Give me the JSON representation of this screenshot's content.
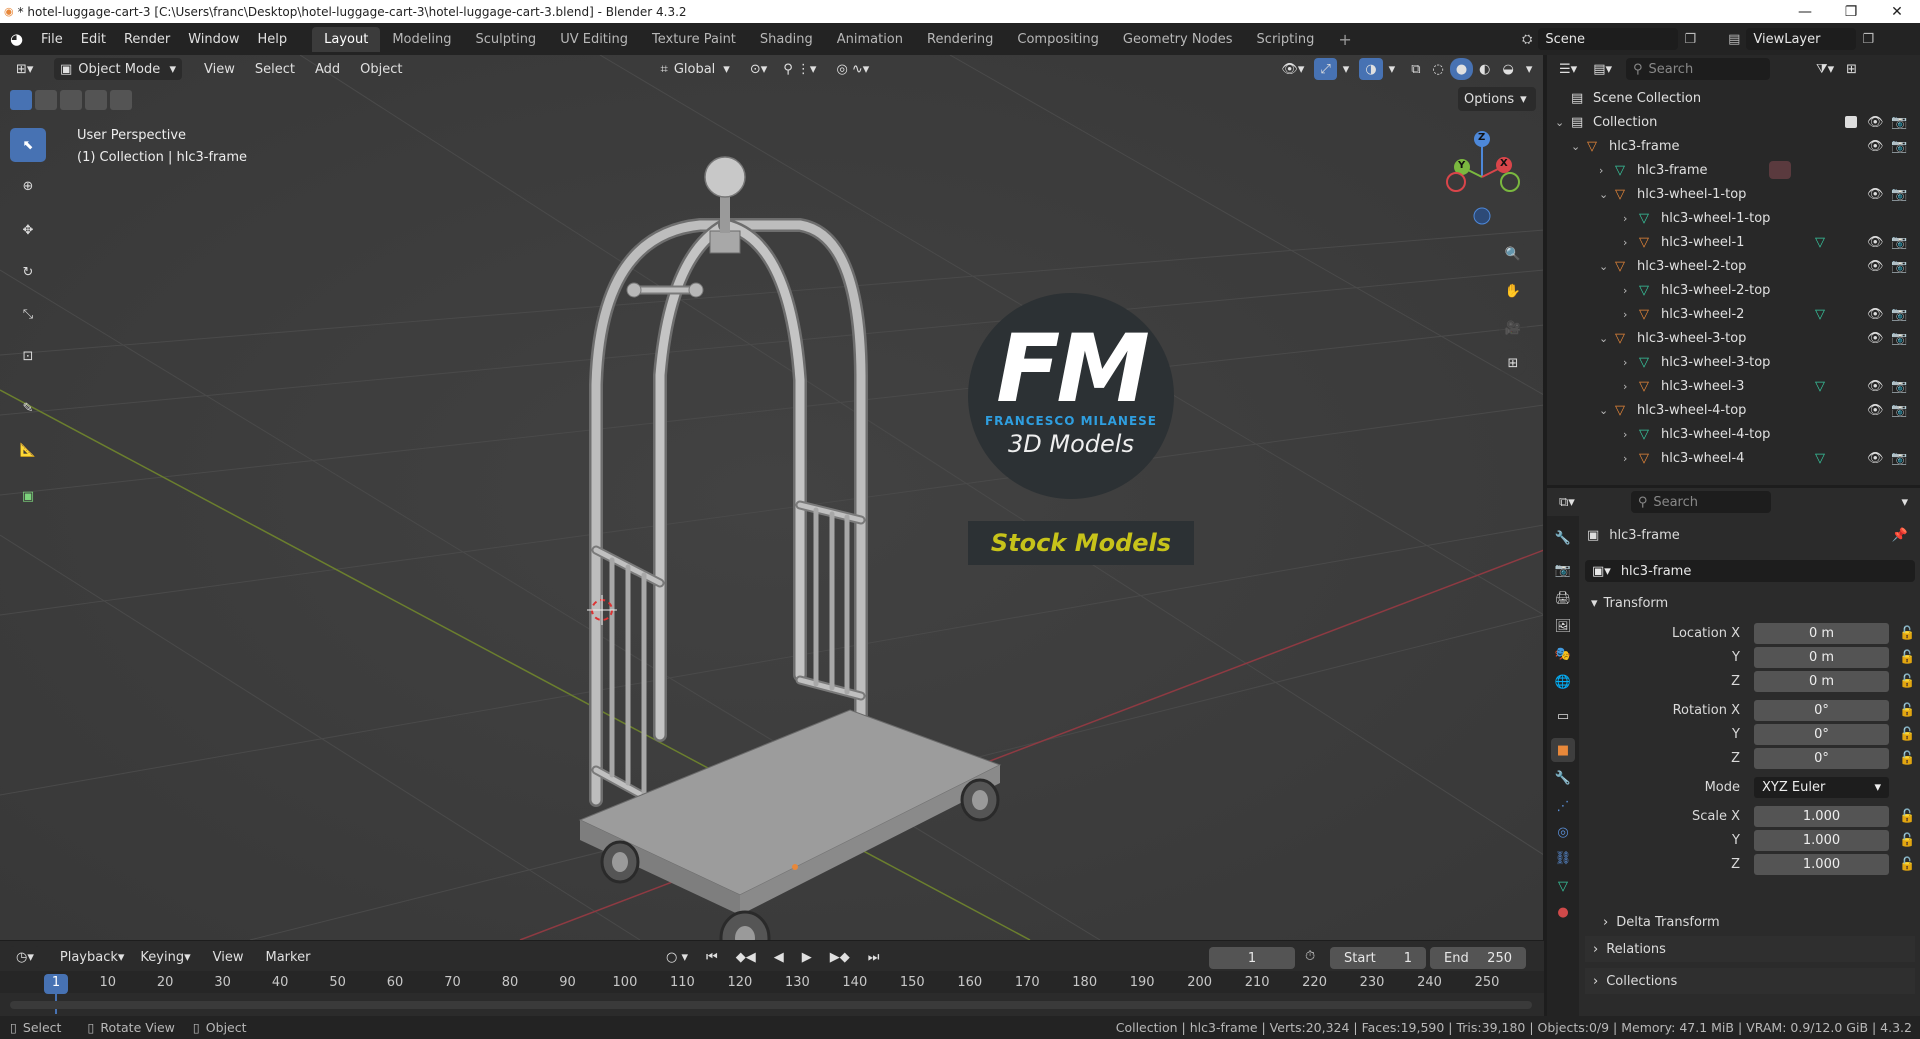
{
  "window": {
    "title": "* hotel-luggage-cart-3 [C:\\Users\\franc\\Desktop\\hotel-luggage-cart-3\\hotel-luggage-cart-3.blend] - Blender 4.3.2",
    "minimize": "—",
    "maximize": "❐",
    "close": "✕"
  },
  "menu": [
    "File",
    "Edit",
    "Render",
    "Window",
    "Help"
  ],
  "workspaces": [
    "Layout",
    "Modeling",
    "Sculpting",
    "UV Editing",
    "Texture Paint",
    "Shading",
    "Animation",
    "Rendering",
    "Compositing",
    "Geometry Nodes",
    "Scripting"
  ],
  "active_workspace": "Layout",
  "scene": {
    "label": "Scene",
    "view_layer": "ViewLayer"
  },
  "viewport": {
    "mode": "Object Mode",
    "menus": [
      "View",
      "Select",
      "Add",
      "Object"
    ],
    "orientation": "Global",
    "options_label": "Options",
    "overlay_title": "User Perspective",
    "overlay_sub": "(1) Collection | hlc3-frame",
    "gizmo_z": "Z",
    "gizmo_y": "Y",
    "gizmo_x": "X",
    "watermark_fm": "FM",
    "watermark_name": "FRANCESCO MILANESE",
    "watermark_3d": "3D Models",
    "watermark_stock": "Stock Models"
  },
  "outliner": {
    "search_placeholder": "Search",
    "rows": [
      {
        "label": "Scene Collection",
        "depth": 0
      },
      {
        "label": "Collection",
        "depth": 1
      },
      {
        "label": "hlc3-frame",
        "depth": 2
      },
      {
        "label": "hlc3-frame",
        "depth": 3
      },
      {
        "label": "hlc3-wheel-1-top",
        "depth": 3
      },
      {
        "label": "hlc3-wheel-1-top",
        "depth": 4
      },
      {
        "label": "hlc3-wheel-1",
        "depth": 4
      },
      {
        "label": "hlc3-wheel-2-top",
        "depth": 3
      },
      {
        "label": "hlc3-wheel-2-top",
        "depth": 4
      },
      {
        "label": "hlc3-wheel-2",
        "depth": 4
      },
      {
        "label": "hlc3-wheel-3-top",
        "depth": 3
      },
      {
        "label": "hlc3-wheel-3-top",
        "depth": 4
      },
      {
        "label": "hlc3-wheel-3",
        "depth": 4
      },
      {
        "label": "hlc3-wheel-4-top",
        "depth": 3
      },
      {
        "label": "hlc3-wheel-4-top",
        "depth": 4
      },
      {
        "label": "hlc3-wheel-4",
        "depth": 4
      }
    ]
  },
  "properties": {
    "search_placeholder": "Search",
    "object_name": "hlc3-frame",
    "datablock_name": "hlc3-frame",
    "transform_header": "Transform",
    "location_label": "Location X",
    "rotation_label": "Rotation X",
    "scale_label": "Scale X",
    "y_label": "Y",
    "z_label": "Z",
    "location": [
      "0 m",
      "0 m",
      "0 m"
    ],
    "rotation": [
      "0°",
      "0°",
      "0°"
    ],
    "mode_label": "Mode",
    "mode_value": "XYZ Euler",
    "scale": [
      "1.000",
      "1.000",
      "1.000"
    ],
    "delta_transform": "Delta Transform",
    "relations": "Relations",
    "collections": "Collections"
  },
  "timeline": {
    "menus": [
      "Playback",
      "Keying",
      "View",
      "Marker"
    ],
    "current_frame": "1",
    "start_label": "Start",
    "start_value": "1",
    "end_label": "End",
    "end_value": "250",
    "ticks": [
      "1",
      "10",
      "20",
      "30",
      "40",
      "50",
      "60",
      "70",
      "80",
      "90",
      "100",
      "110",
      "120",
      "130",
      "140",
      "150",
      "160",
      "170",
      "180",
      "190",
      "200",
      "210",
      "220",
      "230",
      "240",
      "250"
    ]
  },
  "statusbar": {
    "select": "Select",
    "rotate_view": "Rotate View",
    "object": "Object",
    "stats": "Collection | hlc3-frame | Verts:20,324 | Faces:19,590 | Tris:39,180 | Objects:0/9 | Memory: 47.1 MiB | VRAM: 0.9/12.0 GiB | 4.3.2"
  },
  "colors": {
    "accent": "#4772b3",
    "header_bg": "#232323",
    "viewport_bg": "#3d3d3d",
    "object_orange": "#e8883a",
    "mesh_green": "#38c9a0",
    "watermark_circle": "#2c3134",
    "watermark_blue": "#2f9fe0",
    "watermark_yellow": "#c7c31a"
  }
}
